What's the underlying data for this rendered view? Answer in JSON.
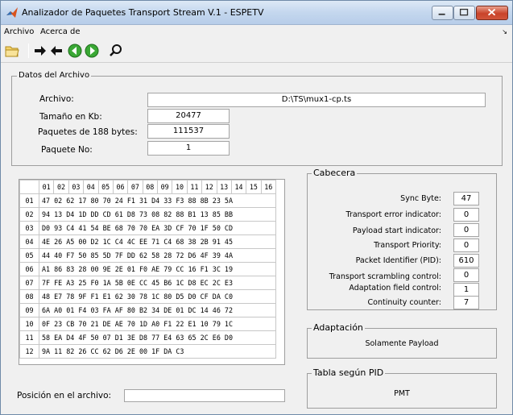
{
  "window": {
    "title": "Analizador de Paquetes Transport Stream V.1  - ESPETV"
  },
  "menu": {
    "items": [
      "Archivo",
      "Acerca de"
    ]
  },
  "datos_archivo": {
    "legend": "Datos del Archivo",
    "archivo_label": "Archivo:",
    "archivo_value": "D:\\TS\\mux1-cp.ts",
    "tamano_label": "Tamaño en Kb:",
    "tamano_value": "20477",
    "paquetes_label": "Paquetes de 188 bytes:",
    "paquetes_value": "111537",
    "paquete_no_label": "Paquete No:",
    "paquete_no_value": "1"
  },
  "hex": {
    "columns": [
      "01",
      "02",
      "03",
      "04",
      "05",
      "06",
      "07",
      "08",
      "09",
      "10",
      "11",
      "12",
      "13",
      "14",
      "15",
      "16"
    ],
    "rows": [
      {
        "num": "01",
        "data": "47 02 62 17 80 70 24 F1 31 D4 33 F3 88 8B 23 5A"
      },
      {
        "num": "02",
        "data": "94 13 D4 1D DD CD 61 D8 73 08 82 88 B1 13 85 BB"
      },
      {
        "num": "03",
        "data": "D0 93 C4 41 54 BE 68 70 70 EA 3D CF 70 1F 50 CD"
      },
      {
        "num": "04",
        "data": "4E 26 A5 00 D2 1C C4 4C EE 71 C4 68 38 2B 91 45"
      },
      {
        "num": "05",
        "data": "44 40 F7 50 85 5D 7F DD 62 58 28 72 D6 4F 39 4A"
      },
      {
        "num": "06",
        "data": "A1 86 83 28 00 9E 2E 01 F0 AE 79 CC 16 F1 3C 19"
      },
      {
        "num": "07",
        "data": "7F FE A3 25 F0 1A 5B 0E CC 45 B6 1C D8 EC 2C E3"
      },
      {
        "num": "08",
        "data": "48 E7 78 9F F1 E1 62 30 78 1C 80 D5 D0 CF DA C0"
      },
      {
        "num": "09",
        "data": "6A A0 01 F4 03 FA AF 80 B2 34 DE 01 DC 14 46 72"
      },
      {
        "num": "10",
        "data": "0F 23 CB 70 21 DE AE 70 1D A0 F1 22 E1 10 79 1C"
      },
      {
        "num": "11",
        "data": "58 EA D4 4F 50 07 D1 3E D8 77 E4 63 65 2C E6 D0"
      },
      {
        "num": "12",
        "data": "9A 11 82 26 CC 62 D6 2E 00 1F DA C3"
      }
    ]
  },
  "posicion": {
    "label": "Posición en el archivo:",
    "value": ""
  },
  "cabecera": {
    "legend": "Cabecera",
    "fields": [
      {
        "label": "Sync Byte:",
        "value": "47"
      },
      {
        "label": "Transport error indicator:",
        "value": "0"
      },
      {
        "label": "Payload start indicator:",
        "value": "0"
      },
      {
        "label": "Transport Priority:",
        "value": "0"
      },
      {
        "label": "Packet Identifier (PID):",
        "value": "610"
      },
      {
        "label": "Transport scrambling control:",
        "value": "0"
      },
      {
        "label": "Adaptation field control:",
        "value": "1"
      },
      {
        "label": "Continuity counter:",
        "value": "7"
      }
    ]
  },
  "adaptacion": {
    "legend": "Adaptación",
    "value": "Solamente Payload"
  },
  "tabla_pid": {
    "legend": "Tabla según PID",
    "value": "PMT"
  },
  "icons": [
    "folder-open-icon",
    "arrow-right-icon",
    "arrow-left-icon",
    "green-back-icon",
    "green-forward-icon",
    "magnifier-icon"
  ]
}
